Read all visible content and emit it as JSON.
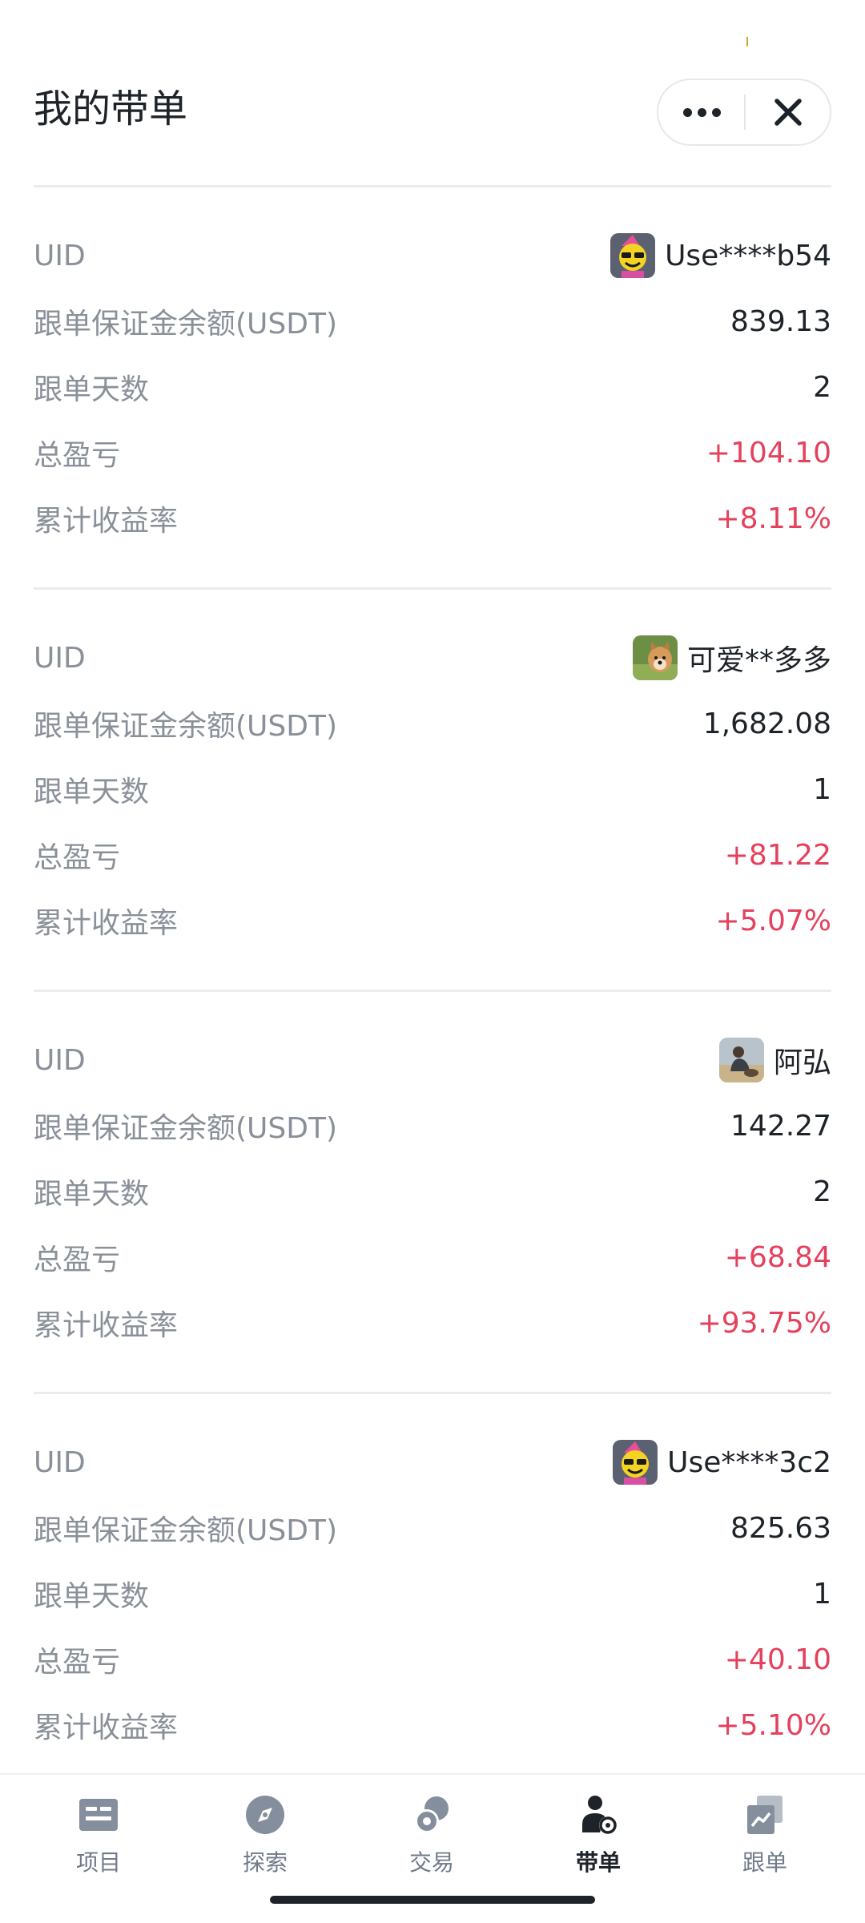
{
  "header": {
    "title": "我的带单",
    "more_icon": "more-dots-icon",
    "close_icon": "close-icon"
  },
  "records": [
    {
      "uid_label": "UID",
      "user": "Use****b54",
      "avatar": "smiley-party-avatar",
      "margin_label": "跟单保证金余额(USDT)",
      "margin": "839.13",
      "days_label": "跟单天数",
      "days": "2",
      "pnl_label": "总盈亏",
      "pnl": "+104.10",
      "roi_label": "累计收益率",
      "roi": "+8.11%"
    },
    {
      "uid_label": "UID",
      "user": "可爱**多多",
      "avatar": "dog-photo-avatar",
      "margin_label": "跟单保证金余额(USDT)",
      "margin": "1,682.08",
      "days_label": "跟单天数",
      "days": "1",
      "pnl_label": "总盈亏",
      "pnl": "+81.22",
      "roi_label": "累计收益率",
      "roi": "+5.07%"
    },
    {
      "uid_label": "UID",
      "user": "阿弘",
      "avatar": "person-photo-avatar",
      "margin_label": "跟单保证金余额(USDT)",
      "margin": "142.27",
      "days_label": "跟单天数",
      "days": "2",
      "pnl_label": "总盈亏",
      "pnl": "+68.84",
      "roi_label": "累计收益率",
      "roi": "+93.75%"
    },
    {
      "uid_label": "UID",
      "user": "Use****3c2",
      "avatar": "smiley-party-avatar",
      "margin_label": "跟单保证金余额(USDT)",
      "margin": "825.63",
      "days_label": "跟单天数",
      "days": "1",
      "pnl_label": "总盈亏",
      "pnl": "+40.10",
      "roi_label": "累计收益率",
      "roi": "+5.10%"
    }
  ],
  "tabs": [
    {
      "label": "项目",
      "icon": "project-icon",
      "active": false
    },
    {
      "label": "探索",
      "icon": "compass-icon",
      "active": false
    },
    {
      "label": "交易",
      "icon": "coins-icon",
      "active": false
    },
    {
      "label": "带单",
      "icon": "lead-trader-icon",
      "active": true
    },
    {
      "label": "跟单",
      "icon": "copy-trade-icon",
      "active": false
    }
  ],
  "colors": {
    "positive": "#e5405c",
    "label": "#8a9099",
    "text": "#1e2329",
    "divider": "#eaecef"
  }
}
